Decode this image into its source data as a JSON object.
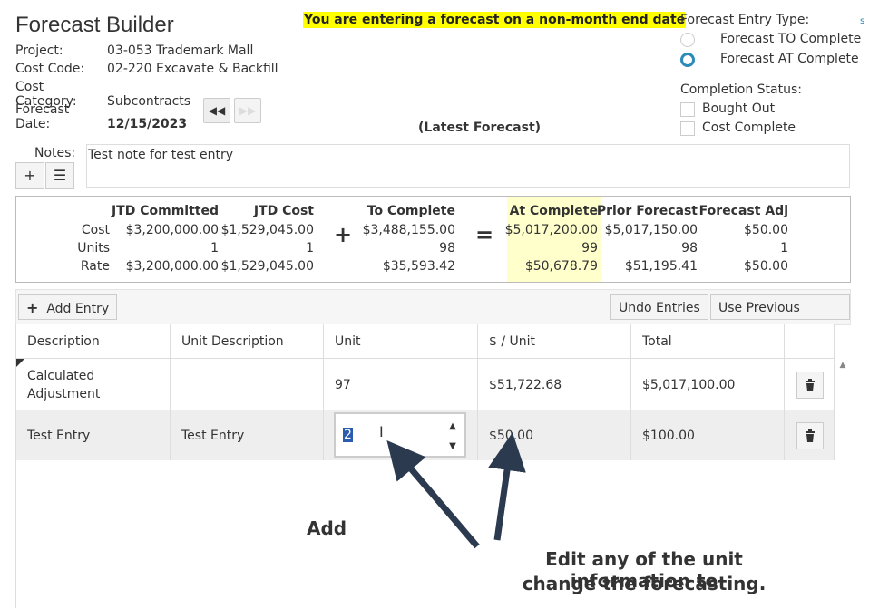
{
  "header": {
    "title": "Forecast Builder",
    "warning": "You are entering a forecast on a non-month end date",
    "project_label": "Project:",
    "project_value": "03-053 Trademark Mall",
    "cost_code_label": "Cost Code:",
    "cost_code_value": "02-220 Excavate & Backfill",
    "cost_category_label": "Cost Category:",
    "cost_category_value": "Subcontracts",
    "forecast_date_label": "Forecast Date:",
    "forecast_date_value": "12/15/2023",
    "latest_label": "(Latest Forecast)"
  },
  "entry_type": {
    "label": "Forecast Entry Type:",
    "options": [
      {
        "label": "Forecast TO Complete",
        "selected": false
      },
      {
        "label": "Forecast AT Complete",
        "selected": true
      }
    ]
  },
  "completion": {
    "label": "Completion Status:",
    "options": [
      {
        "label": "Bought Out",
        "checked": false
      },
      {
        "label": "Cost Complete",
        "checked": false
      }
    ]
  },
  "notes": {
    "label": "Notes:",
    "value": "Test note for test entry"
  },
  "summary": {
    "row_labels": [
      "Cost",
      "Units",
      "Rate"
    ],
    "columns": [
      {
        "header": "JTD Committed",
        "values": [
          "$3,200,000.00",
          "1",
          "$3,200,000.00"
        ]
      },
      {
        "header": "JTD Cost",
        "values": [
          "$1,529,045.00",
          "1",
          "$1,529,045.00"
        ]
      },
      {
        "header": "To Complete",
        "values": [
          "$3,488,155.00",
          "98",
          "$35,593.42"
        ]
      },
      {
        "header": "At Complete",
        "values": [
          "$5,017,200.00",
          "99",
          "$50,678.79"
        ]
      },
      {
        "header": "Prior Forecast",
        "values": [
          "$5,017,150.00",
          "98",
          "$51,195.41"
        ]
      },
      {
        "header": "Forecast Adj",
        "values": [
          "$50.00",
          "1",
          "$50.00"
        ]
      }
    ],
    "plus": "+",
    "equals": "="
  },
  "toolbar": {
    "add_entry": "Add Entry",
    "undo_entries": "Undo Entries",
    "use_previous": "Use Previous Entries"
  },
  "grid": {
    "headers": [
      "Description",
      "Unit Description",
      "Unit",
      "$ / Unit",
      "Total"
    ],
    "rows": [
      {
        "description": "Calculated Adjustment",
        "unit_description": "",
        "unit": "97",
        "per_unit": "$51,722.68",
        "total": "$5,017,100.00"
      },
      {
        "description": "Test Entry",
        "unit_description": "Test Entry",
        "unit": "2",
        "per_unit": "$50.00",
        "total": "$100.00"
      }
    ]
  },
  "annotations": {
    "add": "Add",
    "edit_line1": "Edit any of the unit information to",
    "edit_line2": "change the forecasting."
  },
  "colors": {
    "highlight_yellow": "#ffff00",
    "at_complete_bg": "#ffffcc",
    "radio_blue": "#2a8ab8",
    "arrow": "#2b3a4f"
  }
}
